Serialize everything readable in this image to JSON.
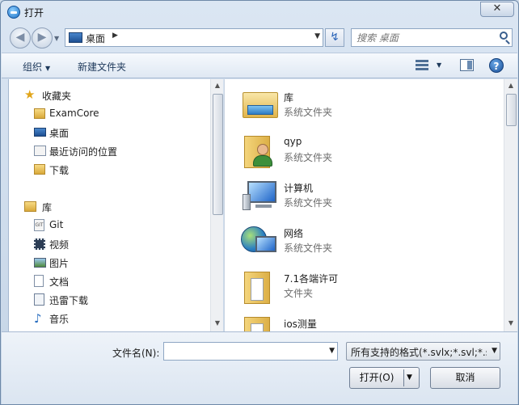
{
  "window": {
    "title": "打开",
    "close_glyph": "✕"
  },
  "address": {
    "location": "桌面",
    "arrow": "▶",
    "dropdown": "▼"
  },
  "search": {
    "placeholder": "搜索 桌面"
  },
  "toolbar": {
    "organize": "组织",
    "new_folder": "新建文件夹",
    "caret": "▼"
  },
  "nav": {
    "favorites_header": "收藏夹",
    "favorites": [
      {
        "label": "ExamCore",
        "icon": "folder-icon"
      },
      {
        "label": "桌面",
        "icon": "desktop-icon"
      },
      {
        "label": "最近访问的位置",
        "icon": "recent-places-icon"
      },
      {
        "label": "下载",
        "icon": "downloads-icon"
      }
    ],
    "libraries_header": "库",
    "libraries": [
      {
        "label": "Git",
        "icon": "git-icon"
      },
      {
        "label": "视频",
        "icon": "video-icon"
      },
      {
        "label": "图片",
        "icon": "pictures-icon"
      },
      {
        "label": "文档",
        "icon": "documents-icon"
      },
      {
        "label": "迅雷下载",
        "icon": "thunder-download-icon"
      },
      {
        "label": "音乐",
        "icon": "music-icon"
      }
    ]
  },
  "files": [
    {
      "name": "库",
      "type": "系统文件夹",
      "icon": "libraries-icon"
    },
    {
      "name": "qyp",
      "type": "系统文件夹",
      "icon": "user-folder-icon"
    },
    {
      "name": "计算机",
      "type": "系统文件夹",
      "icon": "computer-icon"
    },
    {
      "name": "网络",
      "type": "系统文件夹",
      "icon": "network-icon"
    },
    {
      "name": "7.1各端许可",
      "type": "文件夹",
      "icon": "folder-icon"
    },
    {
      "name": "ios测量",
      "type": "",
      "icon": "folder-icon"
    }
  ],
  "bottom": {
    "filename_label": "文件名(N):",
    "filename_value": "",
    "filter": "所有支持的格式(*.svlx;*.svl;*.sv",
    "open_button": "打开(O)",
    "cancel_button": "取消"
  },
  "colors": {
    "accent": "#1a6fc4",
    "folder": "#e8c35a",
    "frame": "#c4d4e6"
  }
}
